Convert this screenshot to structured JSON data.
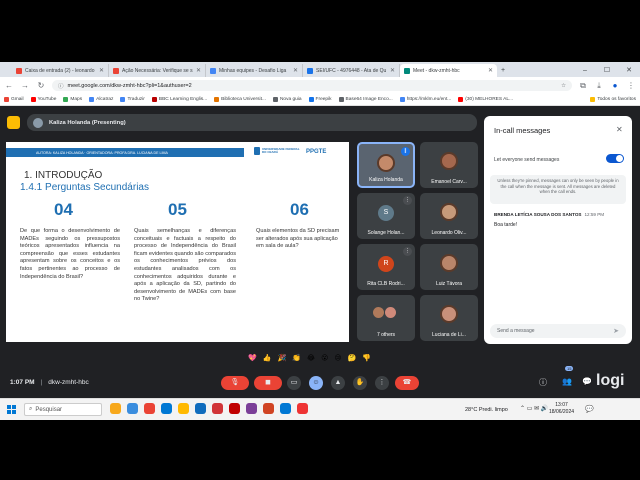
{
  "browser": {
    "tabs": [
      {
        "title": "Caixa de entrada (2) - leonardo",
        "color": "#ea4335"
      },
      {
        "title": "Ação Necessária: Verifique se s",
        "color": "#ea4335"
      },
      {
        "title": "Minhas equipes - Desafio Liga",
        "color": "#4285f4"
      },
      {
        "title": "SEI/UFC - 4976448 - Ata de Qu",
        "color": "#1a73e8"
      },
      {
        "title": "Meet - dkw-zmht-hbc",
        "color": "#00897b",
        "active": true
      }
    ],
    "url": "meet.google.com/dkw-zmht-hbc?pli=1&authuser=2",
    "bookmarks": [
      "Gmail",
      "YouTube",
      "Maps",
      "Alcatraz",
      "Traduzir",
      "BBC Learning Englis...",
      "Biblioteca Universit...",
      "Nova guia",
      "Freepik",
      "Base64 Image Enco...",
      "https://mklm.eu/ent...",
      "(30) MELHORES AL..."
    ],
    "all_bookmarks": "Todos os favoritos"
  },
  "meet": {
    "presenter_label": "Kaliza Holanda (Presenting)",
    "meeting_time": "1:07 PM",
    "meeting_code": "dkw-zmht-hbc",
    "participant_count": "15"
  },
  "slide": {
    "author_line": "AUTORA: KALIZA HOLANDA · ORIENTADORA: PROFA DRA. LUCIANA DE LIMA",
    "logo_ufc": "UNIVERSIDADE FEDERAL DO CEARÁ",
    "logo_ppgte": "PPGTE",
    "heading": "1.   INTRODUÇÃO",
    "subheading": "1.4.1 Perguntas Secundárias",
    "questions": [
      {
        "num": "04",
        "text": "De que forma o desenvolvimento de MADEs seguindo os pressupostos teóricos apresentados influencia na compreensão que esses estudantes apresentam sobre os conceitos e os fatos pertinentes ao processo de Independência do Brasil?"
      },
      {
        "num": "05",
        "text": "Quais semelhanças e diferenças conceituais e factuais a respeito do processo de Independência do Brasil ficam evidentes quando são comparados os conhecimentos prévios dos estudantes analisados com os conhecimentos adquiridos durante e após a aplicação da SD, partindo do desenvolvimento de MADEs com base no Twine?"
      },
      {
        "num": "06",
        "text": "Quais elementos da SD precisam ser alterados após sua aplicação em sala de aula?"
      }
    ]
  },
  "participants": [
    {
      "name": "Kaliza Holanda",
      "kind": "video"
    },
    {
      "name": "Emanoel Carv...",
      "kind": "video"
    },
    {
      "name": "Solange Holan...",
      "initial": "S",
      "color": "#5f7a8a"
    },
    {
      "name": "Leonardo Oliv...",
      "kind": "video"
    },
    {
      "name": "Rita CLB Rodri...",
      "initial": "R",
      "color": "#d0451b"
    },
    {
      "name": "Luiz Távora",
      "kind": "video"
    },
    {
      "name": "7 others",
      "kind": "group"
    },
    {
      "name": "Luciana de Li...",
      "kind": "video"
    }
  ],
  "chat": {
    "title": "In-call messages",
    "toggle_label": "Let everyone send messages",
    "info": "Unless they're pinned, messages can only be seen by people in the call when the message is sent. All messages are deleted when the call ends.",
    "messages": [
      {
        "author": "BRENDA LETÍCIA SOUSA DOS SANTOS",
        "time": "12:59 PM",
        "text": "Boa tarde!"
      }
    ],
    "input_placeholder": "Send a message"
  },
  "reactions": [
    "💖",
    "👍",
    "🎉",
    "👏",
    "😂",
    "😮",
    "😢",
    "🤔",
    "👎"
  ],
  "taskbar": {
    "search_placeholder": "Pesquisar",
    "weather": "28°C  Predi. limpo",
    "clock_time": "13:07",
    "clock_date": "18/06/2024"
  },
  "colors": {
    "accent": "#1a73e8",
    "slide_accent": "#1f6fb2",
    "end_call": "#ea4335"
  }
}
